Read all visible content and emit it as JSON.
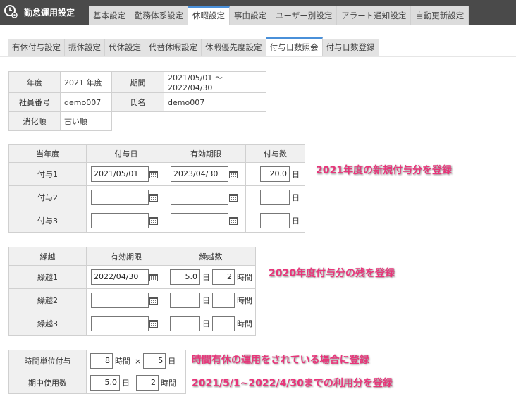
{
  "app": {
    "title": "勤怠運用設定"
  },
  "top_tabs": [
    {
      "label": "基本設定"
    },
    {
      "label": "勤務体系設定"
    },
    {
      "label": "休暇設定"
    },
    {
      "label": "事由設定"
    },
    {
      "label": "ユーザー別設定"
    },
    {
      "label": "アラート通知設定"
    },
    {
      "label": "自動更新設定"
    }
  ],
  "sub_tabs": [
    {
      "label": "有休付与設定"
    },
    {
      "label": "振休設定"
    },
    {
      "label": "代休設定"
    },
    {
      "label": "代替休暇設定"
    },
    {
      "label": "休暇優先度設定"
    },
    {
      "label": "付与日数照会"
    },
    {
      "label": "付与日数登録"
    }
  ],
  "info": {
    "year_label": "年度",
    "year_value": "2021 年度",
    "period_label": "期間",
    "period_value": "2021/05/01 ～ 2022/04/30",
    "emp_label": "社員番号",
    "emp_value": "demo007",
    "name_label": "氏名",
    "name_value": "demo007",
    "order_label": "消化順",
    "order_value": "古い順"
  },
  "grant": {
    "headers": [
      "当年度",
      "付与日",
      "有効期限",
      "付与数"
    ],
    "unit_day": "日",
    "rows": [
      {
        "label": "付与1",
        "date": "2021/05/01",
        "expiry": "2023/04/30",
        "amount": "20.0"
      },
      {
        "label": "付与2",
        "date": "",
        "expiry": "",
        "amount": ""
      },
      {
        "label": "付与3",
        "date": "",
        "expiry": "",
        "amount": ""
      }
    ]
  },
  "carry": {
    "headers": [
      "繰越",
      "有効期限",
      "繰越数"
    ],
    "unit_day": "日",
    "unit_hour": "時間",
    "rows": [
      {
        "label": "繰越1",
        "expiry": "2022/04/30",
        "days": "5.0",
        "hours": "2"
      },
      {
        "label": "繰越2",
        "expiry": "",
        "days": "",
        "hours": ""
      },
      {
        "label": "繰越3",
        "expiry": "",
        "days": "",
        "hours": ""
      }
    ]
  },
  "hourly": {
    "unit_label": "時間単位付与",
    "hours_value": "8",
    "hours_unit": "時間",
    "times": "×",
    "days_value": "5",
    "days_unit": "日",
    "used_label": "期中使用数",
    "used_days": "5.0",
    "used_days_unit": "日",
    "used_hours": "2",
    "used_hours_unit": "時間"
  },
  "annotations": {
    "a1": "2021年度の新規付与分を登録",
    "a2": "2020年度付与分の残を登録",
    "a3": "時間有休の運用をされている場合に登録",
    "a4": "2021/5/1~2022/4/30までの利用分を登録"
  },
  "colors": {
    "topbar": "#4a4a4a",
    "active_tab_accent": "#4a90d9",
    "annotation": "#e8357a"
  }
}
